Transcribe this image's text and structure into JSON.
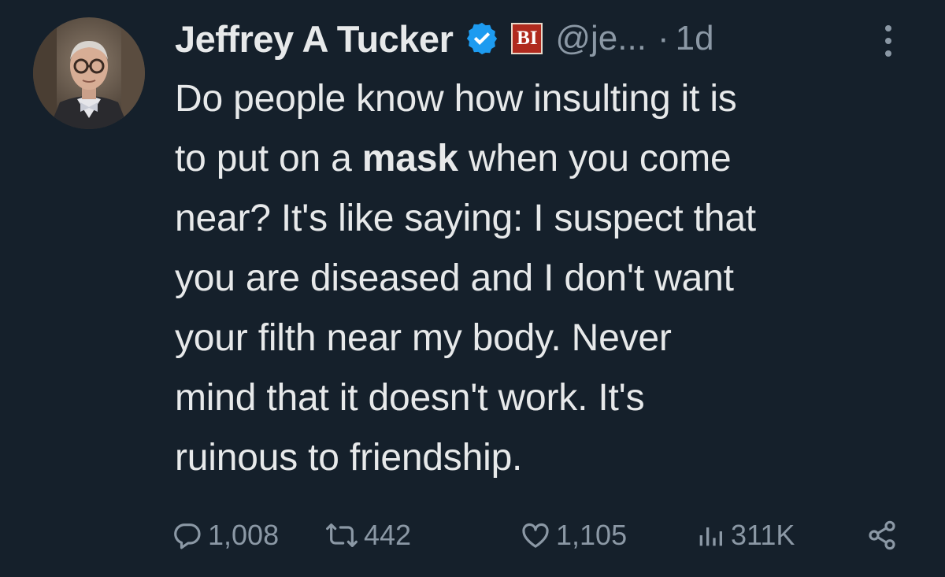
{
  "author": {
    "name": "Jeffrey A Tucker",
    "handle": "@je...",
    "separator": "·",
    "time": "1d",
    "affiliation_badge": "BI",
    "verified_icon": "verified-badge-icon",
    "avatar_icon": "profile-photo"
  },
  "tweet": {
    "lines": [
      {
        "text": "Do people know how insulting it is"
      },
      {
        "before": "to put on a ",
        "bold": "mask",
        "after": " when you come"
      },
      {
        "text": "near? It's like saying: I suspect that"
      },
      {
        "text": "you are diseased and I don't want"
      },
      {
        "text": "your filth near my body. Never"
      },
      {
        "text": "mind that it doesn't work. It's"
      },
      {
        "text": "ruinous to friendship."
      }
    ]
  },
  "actions": {
    "replies": "1,008",
    "reposts": "442",
    "likes": "1,105",
    "views": "311K"
  },
  "colors": {
    "background": "#15202b",
    "text": "#e7e9ea",
    "muted": "#8b98a5",
    "verified": "#1d9bf0",
    "affiliation": "#b02a1e"
  }
}
